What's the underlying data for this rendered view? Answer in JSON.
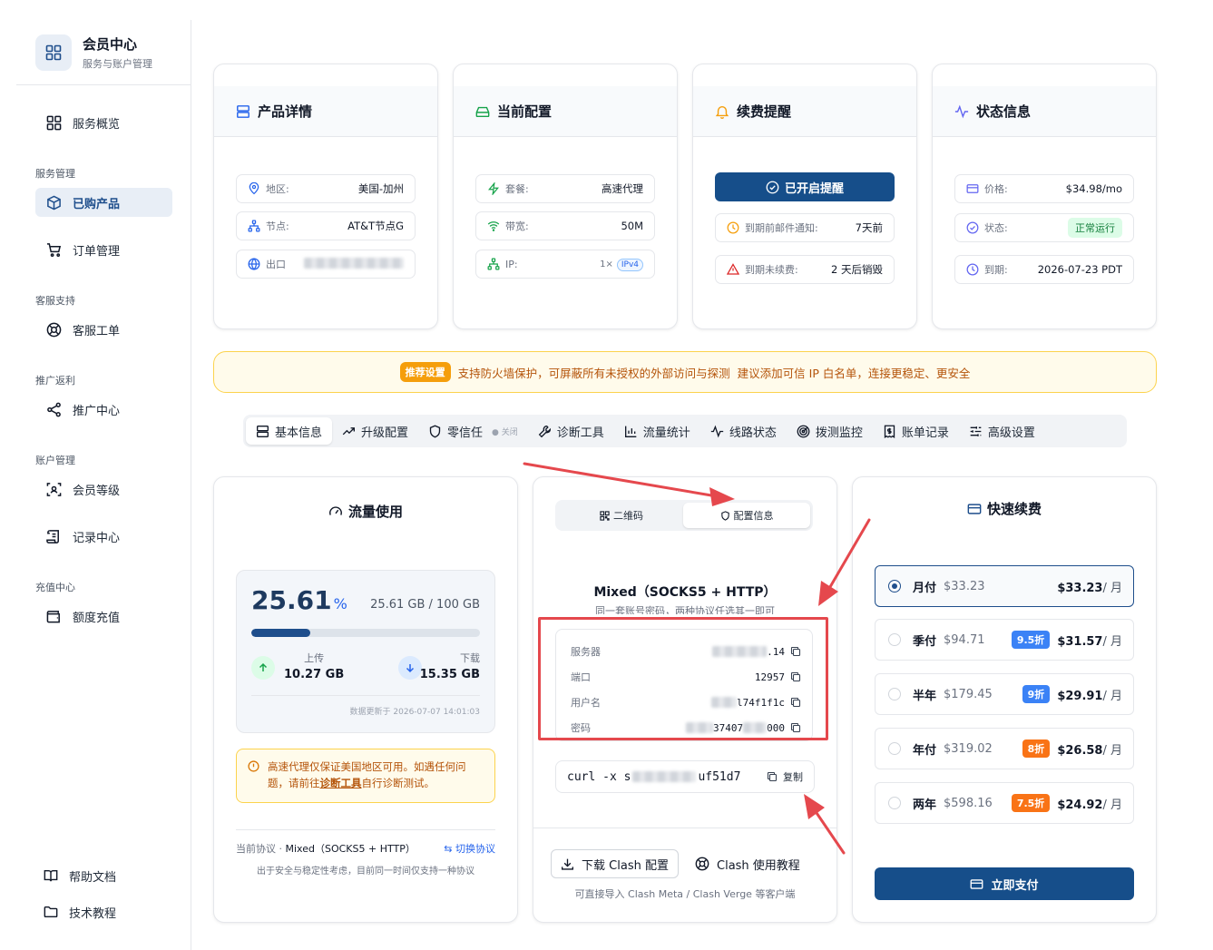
{
  "brand": {
    "title": "会员中心",
    "subtitle": "服务与账户管理"
  },
  "sidebar": {
    "overview": "服务概览",
    "groups": [
      "服务管理",
      "客服支持",
      "推广返利",
      "账户管理",
      "充值中心"
    ],
    "items": [
      "已购产品",
      "订单管理",
      "客服工单",
      "推广中心",
      "会员等级",
      "记录中心",
      "额度充值"
    ],
    "footer": [
      "帮助文档",
      "技术教程"
    ]
  },
  "cards": {
    "product": {
      "title": "产品详情",
      "rows": [
        {
          "label": "地区:",
          "value": "美国-加州"
        },
        {
          "label": "节点:",
          "value": "AT&T节点G"
        },
        {
          "label": "出口",
          "value": ""
        }
      ]
    },
    "config": {
      "title": "当前配置",
      "rows": [
        {
          "label": "套餐:",
          "value": "高速代理"
        },
        {
          "label": "带宽:",
          "value": "50M"
        },
        {
          "label": "IP:",
          "value": "1×",
          "badge": "IPv4"
        }
      ]
    },
    "renew": {
      "title": "续费提醒",
      "button": "已开启提醒",
      "rows": [
        {
          "label": "到期前邮件通知:",
          "value": "7天前"
        },
        {
          "label": "到期未续费:",
          "value": "2 天后销毁"
        }
      ]
    },
    "status": {
      "title": "状态信息",
      "rows": [
        {
          "label": "价格:",
          "value": "$34.98/mo"
        },
        {
          "label": "状态:",
          "value": "正常运行"
        },
        {
          "label": "到期:",
          "value": "2026-07-23 PDT"
        }
      ]
    }
  },
  "banner": {
    "tag": "推荐设置",
    "text1": "支持防火墙保护，可屏蔽所有未授权的外部访问与探测",
    "text2": "建议添加可信 IP 白名单，连接更稳定、更安全"
  },
  "tabs": [
    "基本信息",
    "升级配置",
    "零信任",
    "诊断工具",
    "流量统计",
    "线路状态",
    "拨测监控",
    "账单记录",
    "高级设置"
  ],
  "tab_zero_state": "关闭",
  "traffic": {
    "title": "流量使用",
    "percent": "25.61",
    "percent_unit": "%",
    "percent_value": 25.61,
    "usage": "25.61 GB / 100 GB",
    "upload_label": "上传",
    "upload": "10.27 GB",
    "download_label": "下载",
    "download": "15.35 GB",
    "updated": "数据更新于 2026-07-07 14:01:03",
    "warning_pre": "高速代理仅保证美国地区可用。如遇任何问题，请前往",
    "warning_link": "诊断工具",
    "warning_post": "自行诊断测试。",
    "protocol_label": "当前协议 · ",
    "protocol": "Mixed（SOCKS5 + HTTP）",
    "switch": "切换协议",
    "protocol_note": "出于安全与稳定性考虑，目前同一时间仅支持一种协议"
  },
  "configinfo": {
    "seg": [
      "二维码",
      "配置信息"
    ],
    "title": "Mixed（SOCKS5 + HTTP）",
    "subtitle": "同一套账号密码，两种协议任选其一即可",
    "rows": [
      {
        "label": "服务器",
        "value": ".14"
      },
      {
        "label": "端口",
        "value": "12957"
      },
      {
        "label": "用户名",
        "value": "l74f1f1c"
      },
      {
        "label": "密码",
        "value": "37407"
      }
    ],
    "password_tail": "000",
    "curl": "curl -x s",
    "curl_tail": "uf51d7",
    "copy": "复制",
    "download": "下载 Clash 配置",
    "tutorial": "Clash 使用教程",
    "note": "可直接导入 Clash Meta / Clash Verge 等客户端"
  },
  "renewal": {
    "title": "快速续费",
    "plans": [
      {
        "name": "月付",
        "orig": "$33.23",
        "discount": "",
        "price": "$33.23",
        "unit": "/ 月"
      },
      {
        "name": "季付",
        "orig": "$94.71",
        "discount": "9.5折",
        "price": "$31.57",
        "unit": "/ 月"
      },
      {
        "name": "半年",
        "orig": "$179.45",
        "discount": "9折",
        "price": "$29.91",
        "unit": "/ 月"
      },
      {
        "name": "年付",
        "orig": "$319.02",
        "discount": "8折",
        "price": "$26.58",
        "unit": "/ 月"
      },
      {
        "name": "两年",
        "orig": "$598.16",
        "discount": "7.5折",
        "price": "$24.92",
        "unit": "/ 月"
      }
    ],
    "pay": "立即支付"
  },
  "colors": {
    "primary": "#164e8a",
    "accent_blue": "#2563eb",
    "warning": "#b45309",
    "annotation_red": "#e5484d"
  }
}
